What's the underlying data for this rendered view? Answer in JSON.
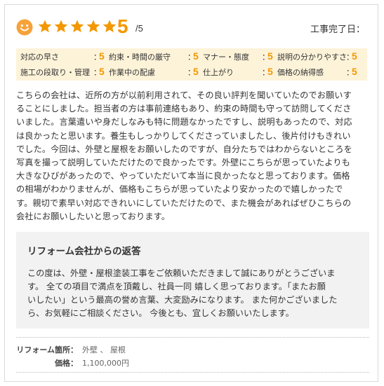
{
  "review": {
    "score": "5",
    "score_max": "/5",
    "star_count": 5,
    "star_color": "#f39800",
    "smiley_icon": "smiley-face-icon",
    "completion_label": "工事完了日：",
    "ratings": [
      {
        "label": "対応の早さ",
        "value": "5"
      },
      {
        "label": "約束・時間の厳守",
        "value": "5"
      },
      {
        "label": "マナー・態度",
        "value": "5"
      },
      {
        "label": "説明の分かりやすさ",
        "value": "5"
      },
      {
        "label": "施工の段取り・管理",
        "value": "5"
      },
      {
        "label": "作業中の配慮",
        "value": "5"
      },
      {
        "label": "仕上がり",
        "value": "5"
      },
      {
        "label": "価格の納得感",
        "value": "5"
      }
    ],
    "colon": "：",
    "body_lines": [
      "こちらの会社は、近所の方が以前利用されて、その良い評判を聞いていたのでお願いす",
      "ることにしました。担当者の方は事前連絡もあり、約束の時間も守って訪問してくださ",
      "いました。言葉遣いや身だしなみも特に問題なかったですし、説明もあったので、対応",
      "は良かったと思います。養生もしっかりしてくださっていましたし、後片付けもきれい",
      "でした。今回は、外壁と屋根をお願いしたのですが、自分たちではわからないところを",
      "写真を撮って説明していただけたので良かったです。外壁にこちらが思っていたよりも",
      "大きなひびがあったので、やっていただいて本当に良かったなと思っております。価格",
      "の相場がわかりませんが、価格もこちらが思っていたより安かったので嬉しかったで",
      "す。親切で素早い対応できれいにしていただけたので、また機会があればぜひこちらの",
      "会社にお願いしたいと思っております。"
    ]
  },
  "reply": {
    "title": "リフォーム会社からの返答",
    "body_lines": [
      "この度は、外壁・屋根塗装工事をご依頼いただきまして誠にありがとうございま",
      "す。 全ての項目で満点を頂戴し、社員一同 嬉しく思っております。「またお願",
      "いしたい」という最高の誉め言葉、大変励みになります。 また何かございました",
      "ら、お気軽にご相談ください。 今後とも、宜しくお願いいたします。"
    ]
  },
  "meta": {
    "location_label": "リフォーム箇所：",
    "location_value": "外壁 、 屋根",
    "price_label": "価格：",
    "price_value": "1,100,000円"
  }
}
